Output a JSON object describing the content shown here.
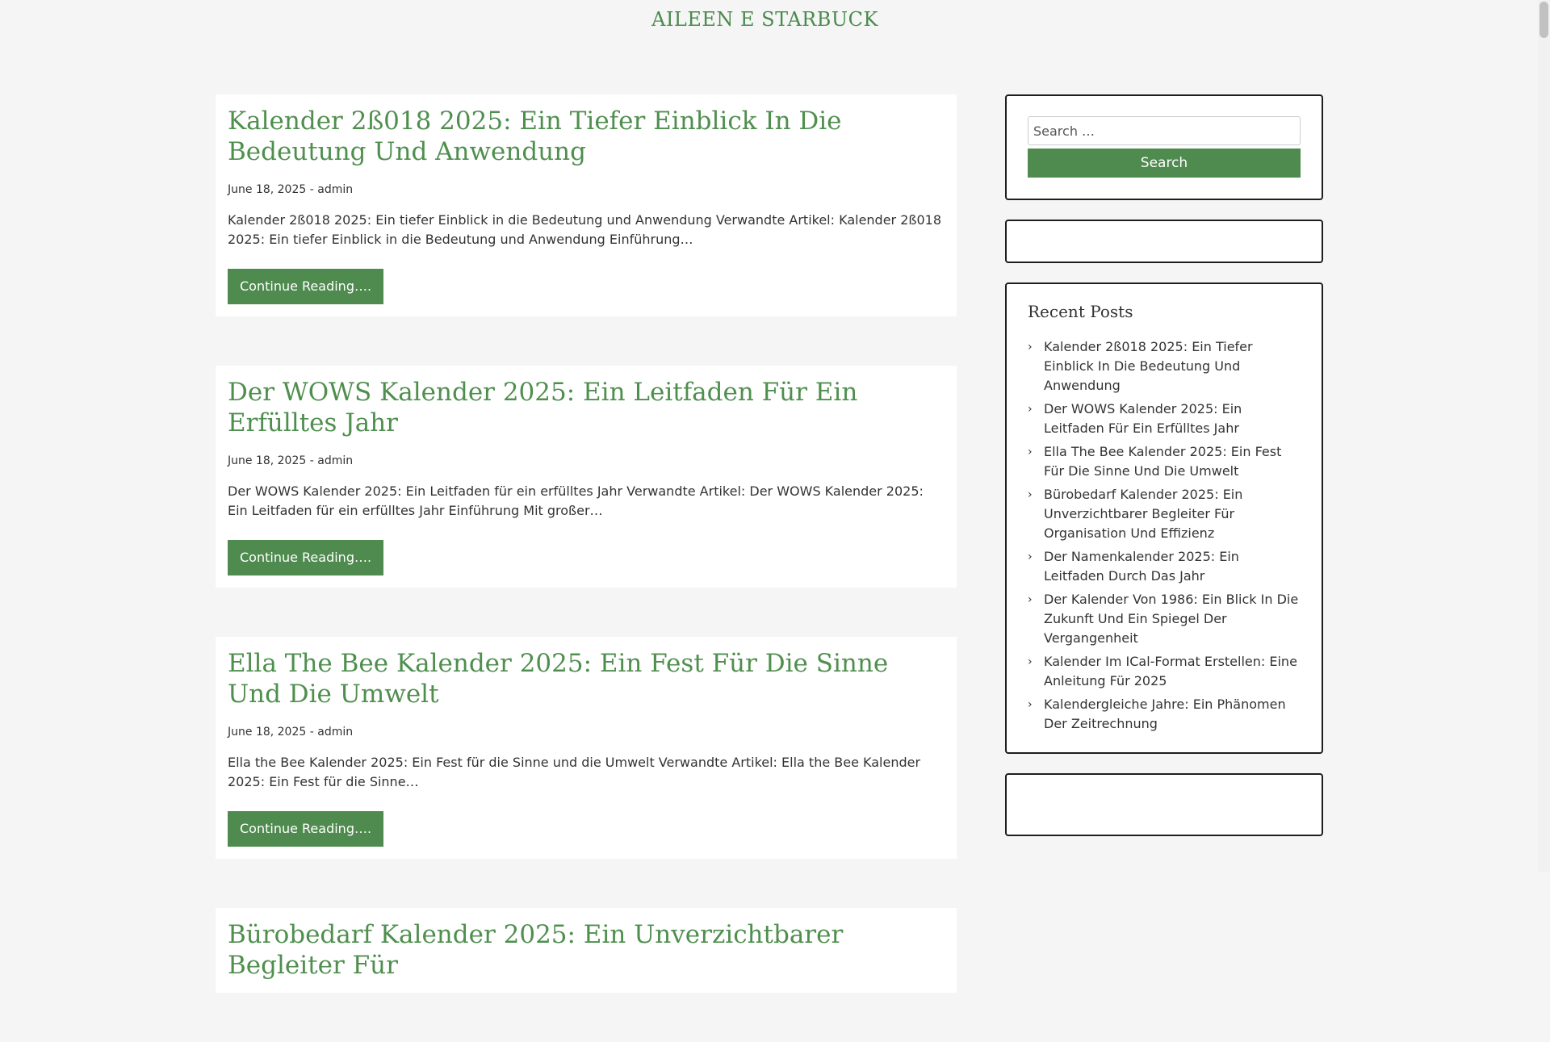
{
  "site": {
    "title": "AILEEN E STARBUCK"
  },
  "posts": [
    {
      "title": "Kalender 2ß018 2025: Ein Tiefer Einblick In Die Bedeutung Und Anwendung",
      "meta": "June 18, 2025 - admin",
      "excerpt": "Kalender 2ß018 2025: Ein tiefer Einblick in die Bedeutung und Anwendung Verwandte Artikel: Kalender 2ß018 2025: Ein tiefer Einblick in die Bedeutung und Anwendung Einführung…",
      "more": "Continue Reading…."
    },
    {
      "title": "Der WOWS Kalender 2025: Ein Leitfaden Für Ein Erfülltes Jahr",
      "meta": "June 18, 2025 - admin",
      "excerpt": "Der WOWS Kalender 2025: Ein Leitfaden für ein erfülltes Jahr Verwandte Artikel: Der WOWS Kalender 2025: Ein Leitfaden für ein erfülltes Jahr Einführung Mit großer…",
      "more": "Continue Reading…."
    },
    {
      "title": "Ella The Bee Kalender 2025: Ein Fest Für Die Sinne Und Die Umwelt",
      "meta": "June 18, 2025 - admin",
      "excerpt": "Ella the Bee Kalender 2025: Ein Fest für die Sinne und die Umwelt Verwandte Artikel: Ella the Bee Kalender 2025: Ein Fest für die Sinne…",
      "more": "Continue Reading…."
    },
    {
      "title": "Bürobedarf Kalender 2025: Ein Unverzichtbarer Begleiter Für",
      "meta": "",
      "excerpt": "",
      "more": ""
    }
  ],
  "sidebar": {
    "search": {
      "placeholder": "Search …",
      "button": "Search"
    },
    "recent": {
      "heading": "Recent Posts",
      "items": [
        "Kalender 2ß018 2025: Ein Tiefer Einblick In Die Bedeutung Und Anwendung",
        "Der WOWS Kalender 2025: Ein Leitfaden Für Ein Erfülltes Jahr",
        "Ella The Bee Kalender 2025: Ein Fest Für Die Sinne Und Die Umwelt",
        "Bürobedarf Kalender 2025: Ein Unverzichtbarer Begleiter Für Organisation Und Effizienz",
        "Der Namenkalender 2025: Ein Leitfaden Durch Das Jahr",
        "Der Kalender Von 1986: Ein Blick In Die Zukunft Und Ein Spiegel Der Vergangenheit",
        "Kalender Im ICal-Format Erstellen: Eine Anleitung Für 2025",
        "Kalendergleiche Jahre: Ein Phänomen Der Zeitrechnung"
      ]
    }
  },
  "icons": {
    "list_bullet": "chevron-right-icon"
  },
  "colors": {
    "accent": "#4f8a4f",
    "title_green": "#4f8f4e",
    "background": "#f5f5f5"
  }
}
